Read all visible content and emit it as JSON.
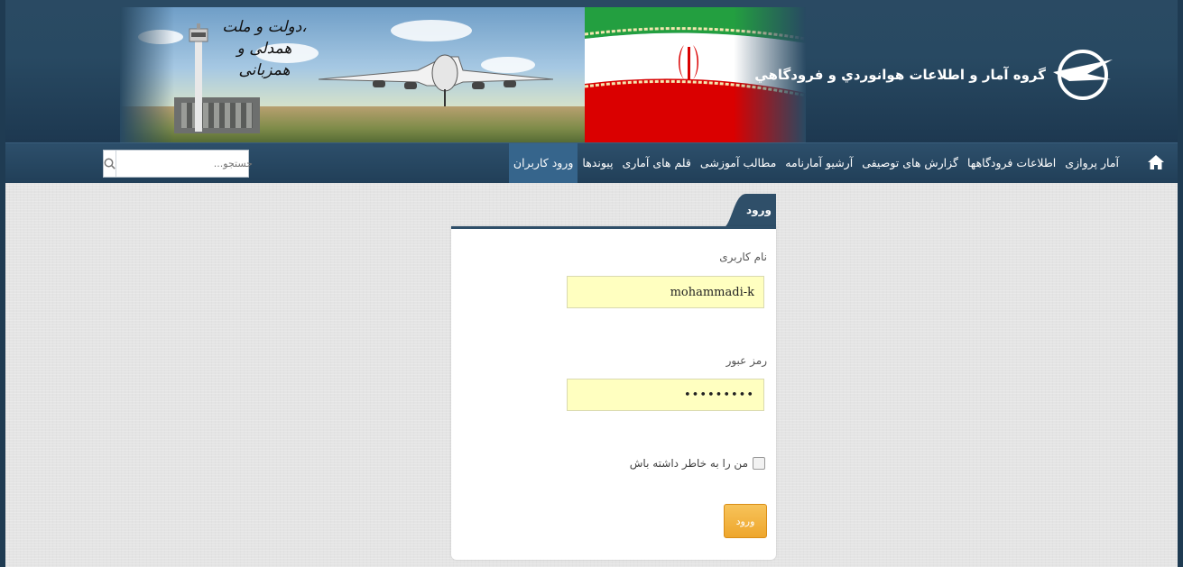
{
  "header": {
    "site_title": "گروه آمار و اطلاعات هوانوردي و فرودگاهي",
    "slogan_line1": "دولت و ملت،",
    "slogan_line2": "همدلی و همزبانی"
  },
  "nav": {
    "items": [
      "آمار پروازی",
      "اطلاعات فرودگاهها",
      "گزارش های توصیفی",
      "آرشیو آمارنامه",
      "مطالب آموزشی",
      "قلم های آماری",
      "پیوندها",
      "ورود کاربران"
    ],
    "active_index": 7
  },
  "search": {
    "placeholder": "جستجو..."
  },
  "login": {
    "tab_label": "ورود",
    "username_label": "نام کاربری",
    "username_value": "mohammadi-k",
    "password_label": "رمز عبور",
    "password_value": "•••••••••",
    "remember_label": "من را به خاطر داشته باش",
    "submit_label": "ورود"
  },
  "colors": {
    "header_bg": "#284962",
    "nav_active": "#36658c",
    "field_bg": "#ffffc0",
    "button_bg": "#eea62c"
  },
  "icons": [
    "home-icon",
    "search-icon",
    "site-logo-icon"
  ]
}
